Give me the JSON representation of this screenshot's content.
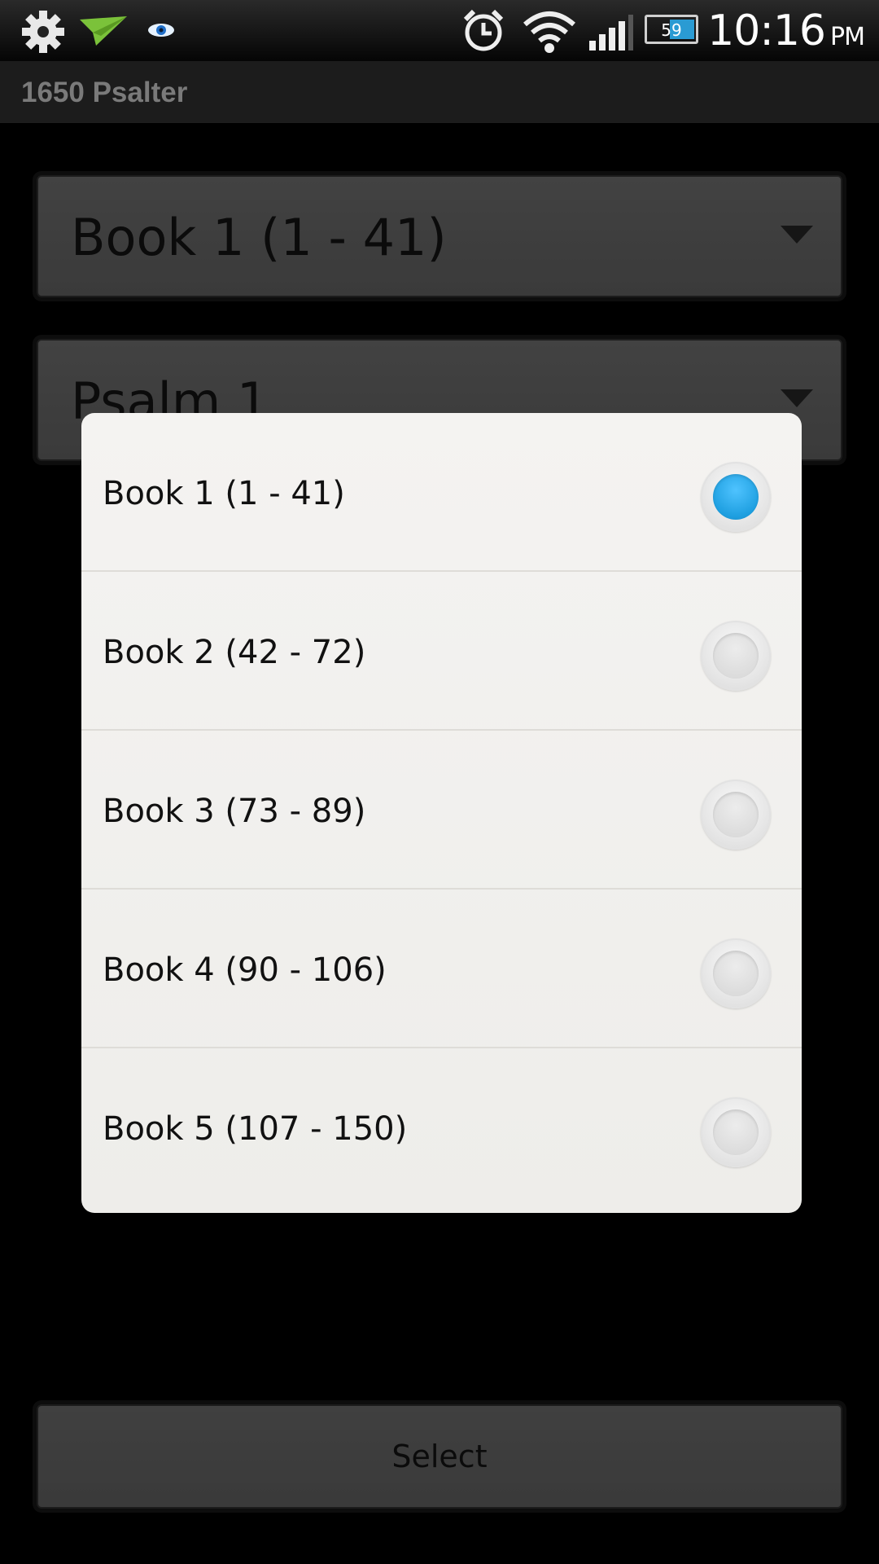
{
  "status_bar": {
    "icons": [
      "settings-gear-icon",
      "paper-plane-icon",
      "eye-icon",
      "alarm-clock-icon",
      "wifi-icon",
      "signal-icon",
      "battery-icon"
    ],
    "battery_level": "59",
    "time": "10:16",
    "ampm": "PM"
  },
  "app": {
    "title": "1650 Psalter"
  },
  "book_spinner": {
    "value": "Book 1 (1 - 41)"
  },
  "psalm_spinner": {
    "value": "Psalm 1"
  },
  "dialog": {
    "options": [
      {
        "label": "Book 1 (1 - 41)",
        "selected": true
      },
      {
        "label": "Book 2 (42 - 72)",
        "selected": false
      },
      {
        "label": "Book 3 (73 - 89)",
        "selected": false
      },
      {
        "label": "Book 4 (90 - 106)",
        "selected": false
      },
      {
        "label": "Book 5 (107 - 150)",
        "selected": false
      }
    ]
  },
  "select_button": {
    "label": "Select"
  },
  "colors": {
    "radio_selected": "#1e9fe0",
    "background": "#000000",
    "dialog_bg": "#f3f2ef"
  }
}
